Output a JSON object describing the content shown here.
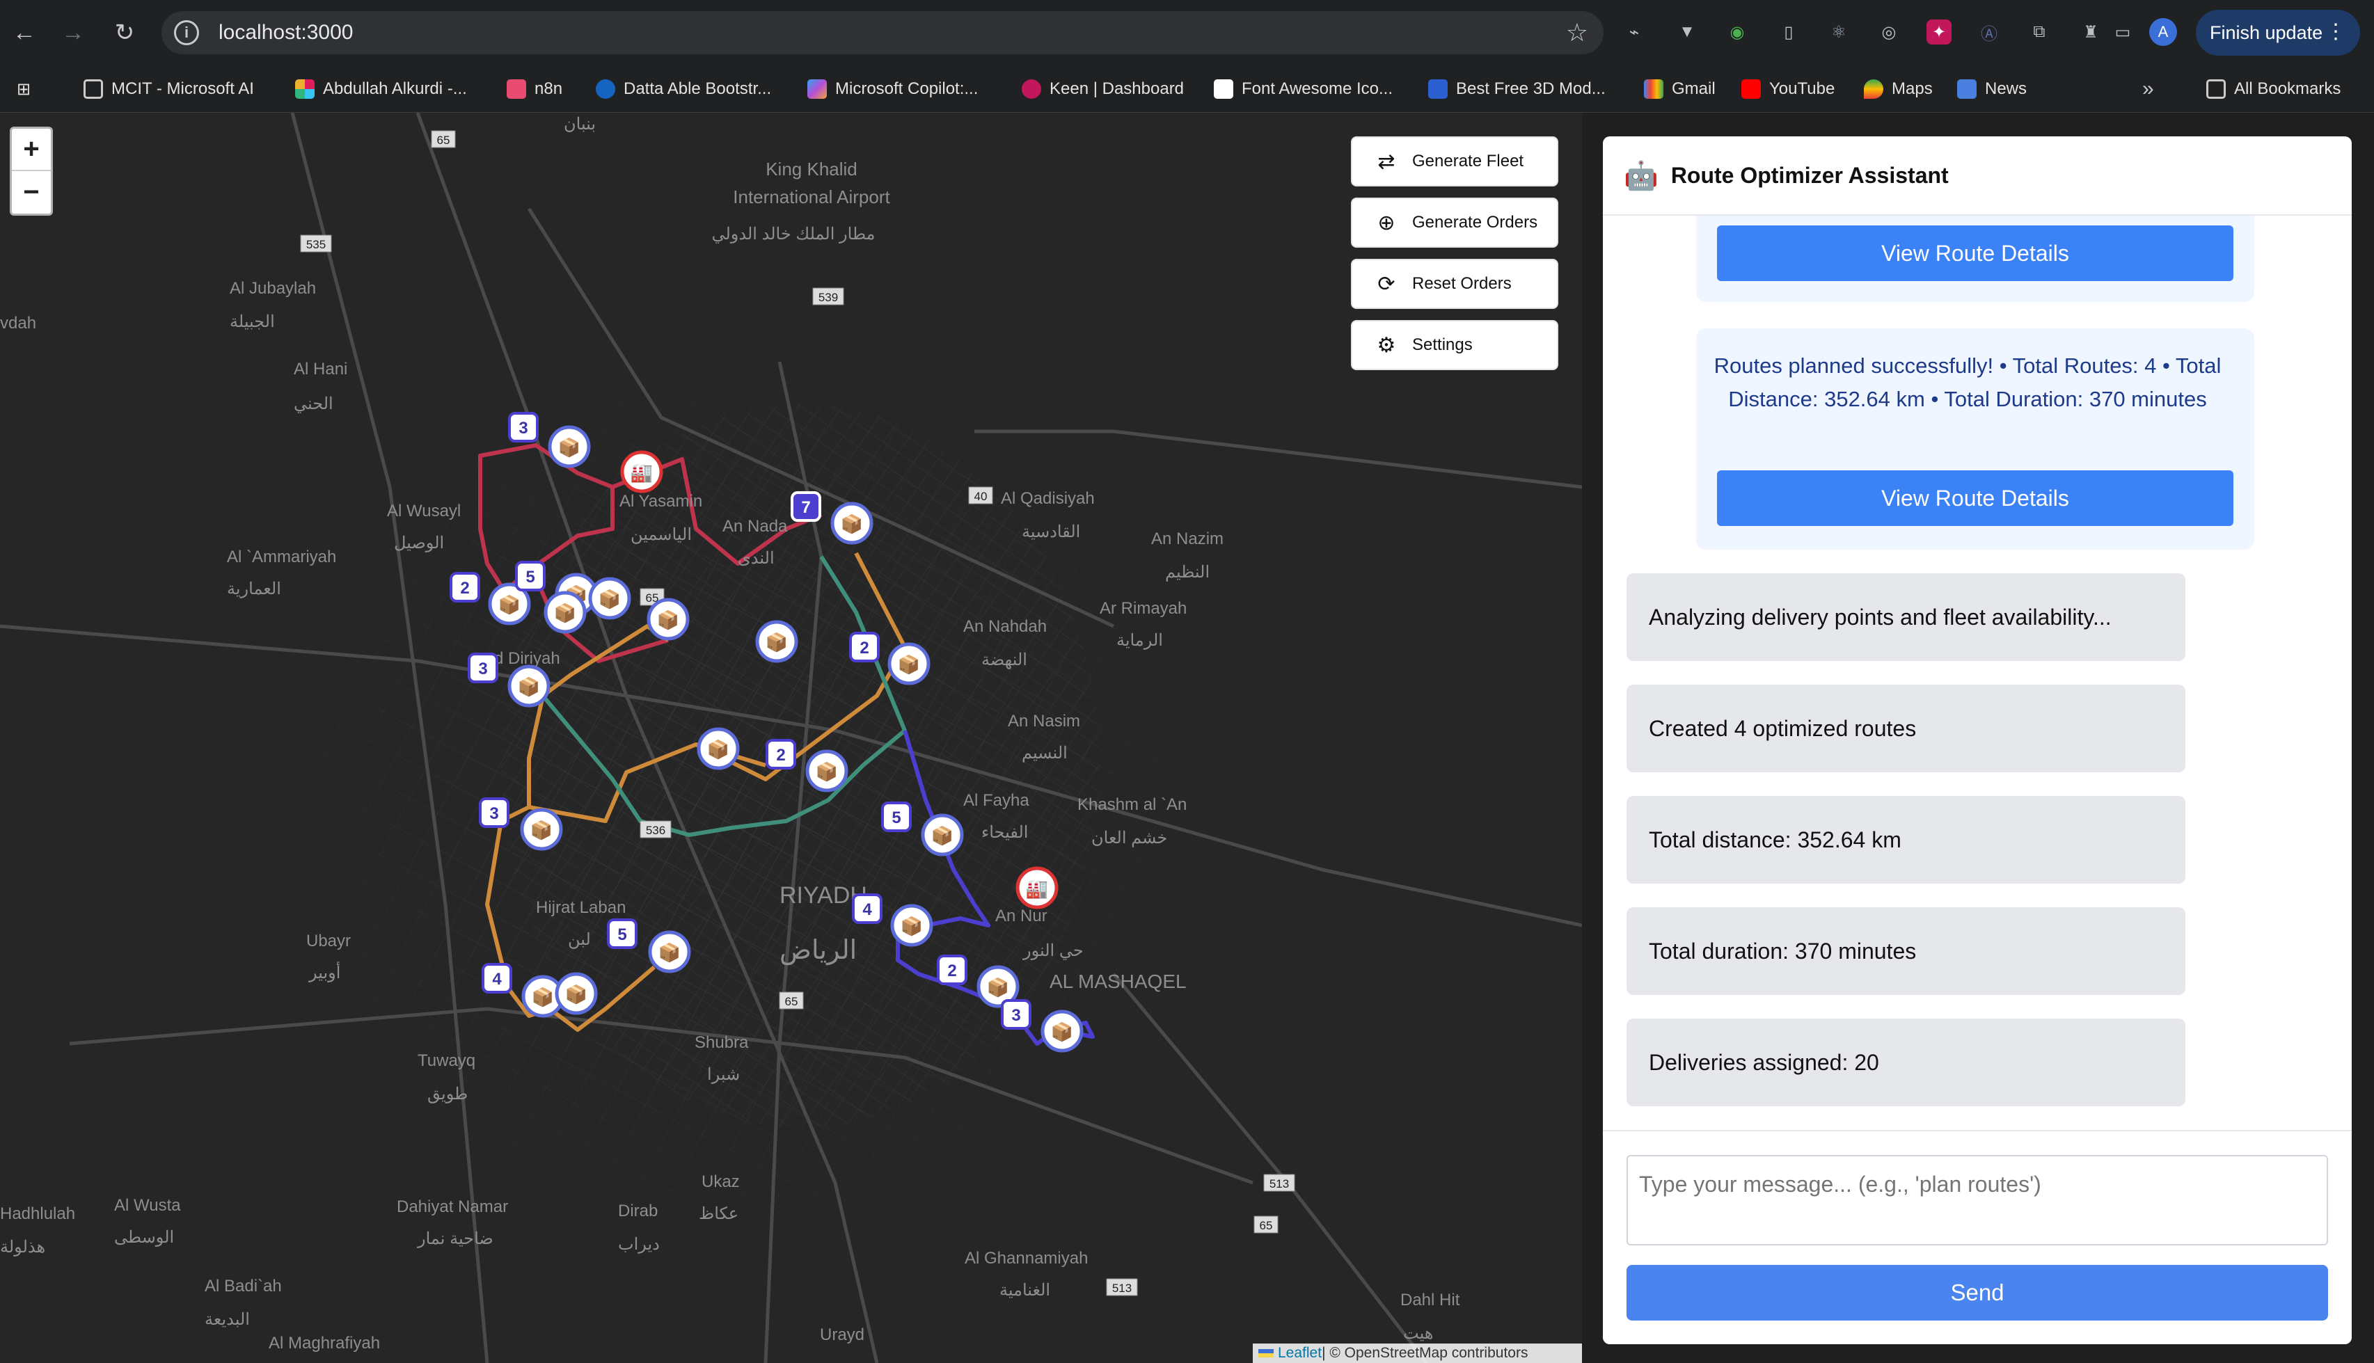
{
  "browser": {
    "url": "localhost:3000",
    "finish_update": "Finish update",
    "avatar_letter": "A",
    "bookmarks": [
      {
        "label": "MCIT - Microsoft AI",
        "icon": "folder-icon"
      },
      {
        "label": "Abdullah Alkurdi -...",
        "icon": "slack-icon"
      },
      {
        "label": "n8n",
        "icon": "n8n-icon"
      },
      {
        "label": "Datta Able Bootstr...",
        "icon": "datta-icon"
      },
      {
        "label": "Microsoft Copilot:...",
        "icon": "copilot-icon"
      },
      {
        "label": "Keen | Dashboard",
        "icon": "keen-icon"
      },
      {
        "label": "Font Awesome Ico...",
        "icon": "flag-icon"
      },
      {
        "label": "Best Free 3D Mod...",
        "icon": "3d-icon"
      },
      {
        "label": "Gmail",
        "icon": "gmail-icon"
      },
      {
        "label": "YouTube",
        "icon": "youtube-icon"
      },
      {
        "label": "Maps",
        "icon": "maps-icon"
      },
      {
        "label": "News",
        "icon": "news-icon"
      }
    ],
    "all_bookmarks": "All Bookmarks"
  },
  "map": {
    "zoom_in": "+",
    "zoom_out": "−",
    "buttons": {
      "generate_fleet": "Generate Fleet",
      "generate_orders": "Generate Orders",
      "reset_orders": "Reset Orders",
      "settings": "Settings"
    },
    "attribution_leaflet": "Leaflet",
    "attribution_rest": " | © OpenStreetMap contributors",
    "labels": {
      "airport1": "King Khalid",
      "airport2": "International Airport",
      "airport_ar": "مطار الملك خالد الدولي",
      "riyadh": "RIYADH",
      "riyadh_ar": "الرياض",
      "al_mashaqel": "AL MASHAQEL",
      "al_jubaylah": "Al Jubaylah",
      "al_jubaylah_ar": "الجبيلة",
      "al_hani": "Al Hani",
      "al_hani_ar": "الحني",
      "al_wusayl": "Al Wusayl",
      "al_wusayl_ar": "الوصيل",
      "al_ammariyah": "Al `Ammariyah",
      "al_ammariyah_ar": "العمارية",
      "al_yasamin": "Al Yasamin",
      "al_yasamin_ar": "الياسمين",
      "an_nada": "An Nada",
      "an_nada_ar": "الندى",
      "al_qadisiyah": "Al Qadisiyah",
      "al_qadisiyah_ar": "القادسية",
      "an_nazim": "An Nazim",
      "an_nazim_ar": "النظيم",
      "ar_rimayah": "Ar Rimayah",
      "ar_rimayah_ar": "الرماية",
      "an_nahdah": "An Nahdah",
      "an_nahdah_ar": "النهضة",
      "an_nasim": "An Nasim",
      "an_nasim_ar": "النسيم",
      "al_fayha": "Al Fayha",
      "al_fayha_ar": "الفيحاء",
      "khashm": "Khashm al `An",
      "khashm_ar": "خشم العان",
      "ad_diriyah": "d Diriyah",
      "hijrat_laban": "Hijrat Laban",
      "hijrat_laban_ar": "لبن",
      "an_nur": "An Nur",
      "an_nur_ar": "حي النور",
      "ubayr": "Ubayr",
      "ubayr_ar": "أوبير",
      "tuwayq": "Tuwayq",
      "tuwayq_ar": "طويق",
      "shubra": "Shubra",
      "shubra_ar": "شبرا",
      "ukaz": "Ukaz",
      "ukaz_ar": "عكاظ",
      "dahiyat_namar": "Dahiyat Namar",
      "dahiyat_namar_ar": "ضاحية نمار",
      "dirab": "Dirab",
      "dirab_ar": "ديراب",
      "al_ghannamiyah": "Al Ghannamiyah",
      "al_ghannamiyah_ar": "الغنامية",
      "al_wusta": "Al Wusta",
      "al_wusta_ar": "الوسطى",
      "hadhlulah": "Hadhlulah",
      "hadhlulah_ar": "هذلولة",
      "al_badiah": "Al Badi`ah",
      "al_badiah_ar": "البديعة",
      "al_maghrafiyah": "Al Maghrafiyah",
      "urayd": "Urayd",
      "dahl_hit": "Dahl Hit",
      "dahl_hit_ar": "هيت",
      "vdah": "vdah",
      "banban_ar": "بنبان"
    },
    "shields": {
      "s65a": "65",
      "s535": "535",
      "s539": "539",
      "s40": "40",
      "s65b": "65",
      "s536": "536",
      "s65c": "65",
      "s513a": "513",
      "s65d": "65",
      "s513b": "513"
    },
    "stop_numbers": {
      "n1": "3",
      "n2": "7",
      "n3": "5",
      "n4": "2",
      "n5": "3",
      "n6": "2",
      "n7": "2",
      "n8": "3",
      "n9": "5",
      "n10": "4",
      "n11": "5",
      "n12": "4",
      "n13": "2",
      "n14": "3"
    },
    "route_colors": {
      "red": "#c0334d",
      "orange": "#cf8a3a",
      "teal": "#3f8f7a",
      "blue": "#4c3fcf"
    }
  },
  "assistant": {
    "title": "Route Optimizer Assistant",
    "view_route_details": "View Route Details",
    "success_text": "Routes planned successfully! • Total Routes: 4 • Total Distance: 352.64 km • Total Duration: 370 minutes",
    "messages": [
      "Analyzing delivery points and fleet availability...",
      "Created 4 optimized routes",
      "Total distance: 352.64 km",
      "Total duration: 370 minutes",
      "Deliveries assigned: 20"
    ],
    "input_placeholder": "Type your message... (e.g., 'plan routes')",
    "send": "Send"
  }
}
